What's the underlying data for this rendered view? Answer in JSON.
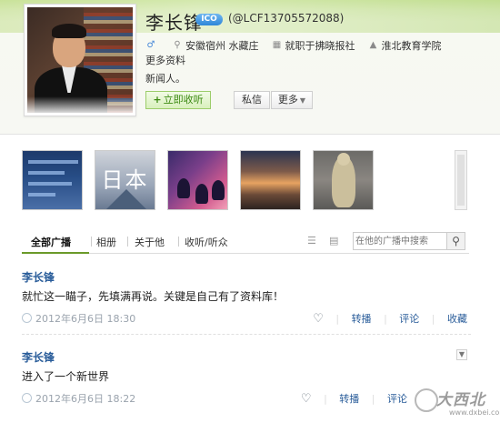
{
  "profile": {
    "name": "李长锋",
    "verify_badge": "ICO",
    "handle": "(@LCF13705572088)",
    "location": "安徽宿州 水藏庄",
    "job": "就职于拂晓报社",
    "school": "淮北教育学院",
    "more_info": "更多资料",
    "bio": "新闻人。"
  },
  "buttons": {
    "follow": "立即收听",
    "follow_plus": "+",
    "message": "私信",
    "more": "更多"
  },
  "album": {
    "thumb2_text": "日本"
  },
  "tabs": {
    "all": "全部广播",
    "photos": "相册",
    "about": "关于他",
    "follows": "收听/听众"
  },
  "search": {
    "placeholder": "在他的广播中搜索"
  },
  "posts": [
    {
      "author": "李长锋",
      "content": "就忙这一瞄子，先填满再说。关键是自己有了资料库！",
      "time": "2012年6月6日 18:30",
      "actions": {
        "repost": "转播",
        "comment": "评论",
        "favorite": "收藏"
      }
    },
    {
      "author": "李长锋",
      "content": "进入了一个新世界",
      "time": "2012年6月6日 18:22",
      "actions": {
        "repost": "转播",
        "comment": "评论"
      }
    }
  ],
  "watermark": {
    "text": "大西北",
    "url": "www.dxbei.com"
  },
  "colors": {
    "accent_green": "#3c8a12",
    "link_blue": "#2a5d9a"
  }
}
